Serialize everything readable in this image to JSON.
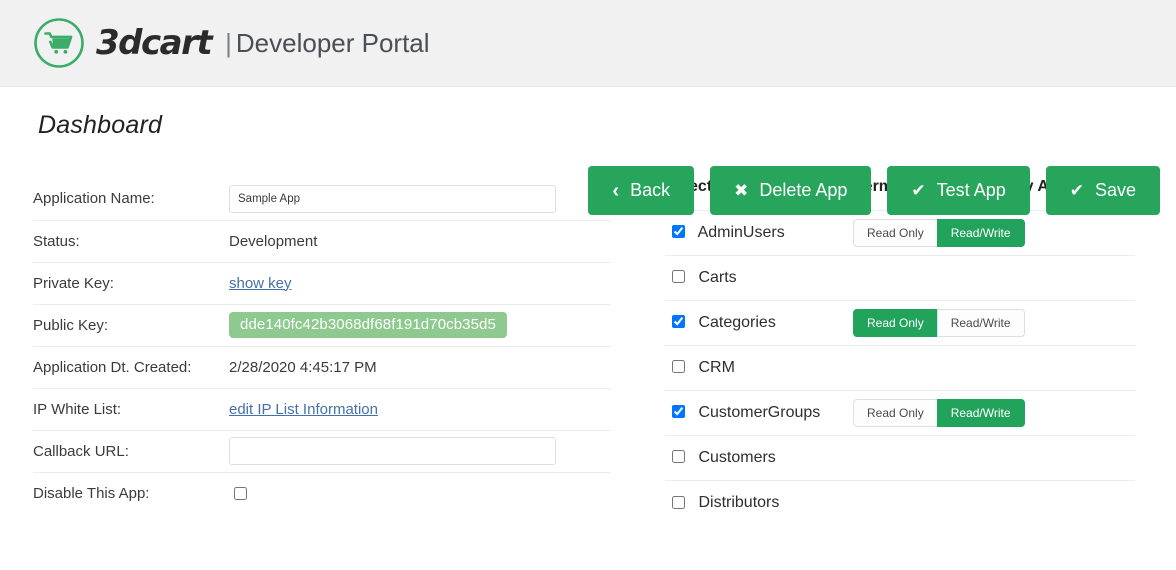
{
  "header": {
    "logo_icon": "shopping-cart-circle-icon",
    "brand": "3dcart",
    "pipe": "|",
    "subtitle": "Developer Portal",
    "brand_color": "#3aad6a"
  },
  "page": {
    "title": "Dashboard"
  },
  "actions": [
    {
      "id": "back",
      "label": "Back",
      "icon": "chevron-left-icon",
      "glyph": "‹"
    },
    {
      "id": "delete-app",
      "label": "Delete App",
      "icon": "close-x-icon",
      "glyph": "✖"
    },
    {
      "id": "test-app",
      "label": "Test App",
      "icon": "check-icon",
      "glyph": "✔"
    },
    {
      "id": "save",
      "label": "Save",
      "icon": "check-icon",
      "glyph": "✔"
    }
  ],
  "button_color": "#27a55c",
  "form": {
    "rows": [
      {
        "label": "Application Name:",
        "type": "input",
        "value": "Sample App",
        "placeholder": ""
      },
      {
        "label": "Status:",
        "type": "text",
        "value": "Development"
      },
      {
        "label": "Private Key:",
        "type": "link",
        "value": "show key"
      },
      {
        "label": "Public Key:",
        "type": "chip",
        "value": "dde140fc42b3068df68f191d70cb35d5"
      },
      {
        "label": "Application Dt. Created:",
        "type": "text",
        "value": "2/28/2020 4:45:17 PM"
      },
      {
        "label": "IP White List:",
        "type": "link",
        "value": "edit IP List Information"
      },
      {
        "label": "Callback URL:",
        "type": "input",
        "value": "",
        "placeholder": ""
      },
      {
        "label": "Disable This App:",
        "type": "checkbox",
        "checked": false
      }
    ]
  },
  "modules": {
    "headers": {
      "module": "Select Module",
      "permissions": "Permissions Needed by App"
    },
    "permission_labels": {
      "read_only": "Read Only",
      "read_write": "Read/Write"
    },
    "rows": [
      {
        "name": "AdminUsers",
        "checked": true,
        "permission": "read_write"
      },
      {
        "name": "Carts",
        "checked": false,
        "permission": null
      },
      {
        "name": "Categories",
        "checked": true,
        "permission": "read_only"
      },
      {
        "name": "CRM",
        "checked": false,
        "permission": null
      },
      {
        "name": "CustomerGroups",
        "checked": true,
        "permission": "read_write"
      },
      {
        "name": "Customers",
        "checked": false,
        "permission": null
      },
      {
        "name": "Distributors",
        "checked": false,
        "permission": null
      }
    ]
  }
}
